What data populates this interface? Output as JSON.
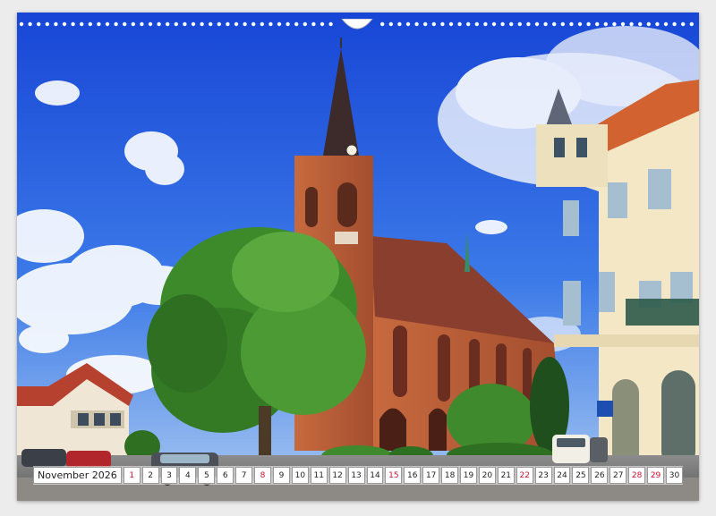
{
  "calendar": {
    "month": "November",
    "year": "2026",
    "days": [
      {
        "n": "1",
        "we": true
      },
      {
        "n": "2",
        "we": false
      },
      {
        "n": "3",
        "we": false
      },
      {
        "n": "4",
        "we": false
      },
      {
        "n": "5",
        "we": false
      },
      {
        "n": "6",
        "we": false
      },
      {
        "n": "7",
        "we": false
      },
      {
        "n": "8",
        "we": true
      },
      {
        "n": "9",
        "we": false
      },
      {
        "n": "10",
        "we": false
      },
      {
        "n": "11",
        "we": false
      },
      {
        "n": "12",
        "we": false
      },
      {
        "n": "13",
        "we": false
      },
      {
        "n": "14",
        "we": false
      },
      {
        "n": "15",
        "we": true
      },
      {
        "n": "16",
        "we": false
      },
      {
        "n": "17",
        "we": false
      },
      {
        "n": "18",
        "we": false
      },
      {
        "n": "19",
        "we": false
      },
      {
        "n": "20",
        "we": false
      },
      {
        "n": "21",
        "we": false
      },
      {
        "n": "22",
        "we": true
      },
      {
        "n": "23",
        "we": false
      },
      {
        "n": "24",
        "we": false
      },
      {
        "n": "25",
        "we": false
      },
      {
        "n": "26",
        "we": false
      },
      {
        "n": "27",
        "we": false
      },
      {
        "n": "28",
        "we": true
      },
      {
        "n": "29",
        "we": true
      },
      {
        "n": "30",
        "we": false
      }
    ]
  },
  "colors": {
    "sky_top": "#1a56e0",
    "sky_bottom": "#7fb2ef",
    "brick": "#b85a35",
    "roof": "#7b3b2b",
    "tree": "#3f8b2c",
    "building": "#f0e4c3",
    "weekend": "#c8102e"
  }
}
